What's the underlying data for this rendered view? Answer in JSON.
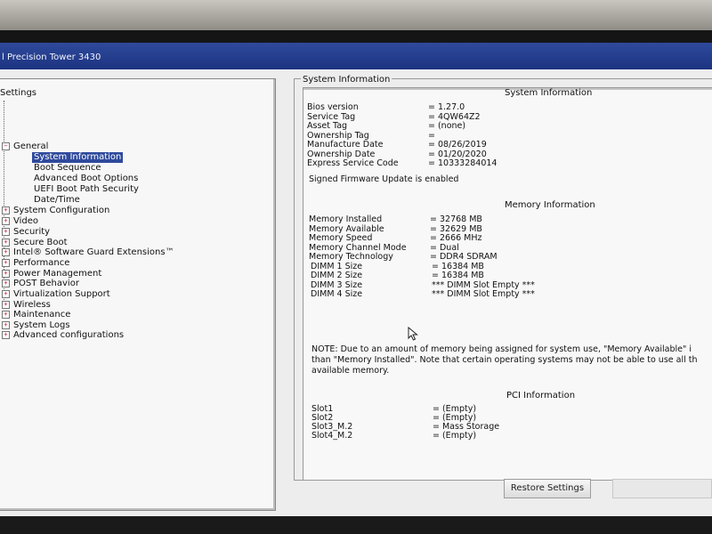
{
  "window": {
    "title": "l Precision Tower 3430"
  },
  "tree": {
    "root_label": "Settings",
    "general": {
      "label": "General",
      "children": [
        {
          "label": "System Information",
          "selected": true
        },
        {
          "label": "Boot Sequence"
        },
        {
          "label": "Advanced Boot Options"
        },
        {
          "label": "UEFI Boot Path Security"
        },
        {
          "label": "Date/Time"
        }
      ]
    },
    "categories": [
      "System Configuration",
      "Video",
      "Security",
      "Secure Boot",
      "Intel® Software Guard Extensions™",
      "Performance",
      "Power Management",
      "POST Behavior",
      "Virtualization Support",
      "Wireless",
      "Maintenance",
      "System Logs",
      "Advanced configurations"
    ]
  },
  "info": {
    "panel_title": "System Information",
    "system": {
      "heading": "System Information",
      "rows": [
        {
          "key": "Bios version",
          "value": "= 1.27.0"
        },
        {
          "key": "Service Tag",
          "value": "= 4QW64Z2"
        },
        {
          "key": "Asset Tag",
          "value": "= (none)"
        },
        {
          "key": "Ownership Tag",
          "value": "="
        },
        {
          "key": "Manufacture Date",
          "value": "= 08/26/2019"
        },
        {
          "key": "Ownership Date",
          "value": "= 01/20/2020"
        },
        {
          "key": "Express Service Code",
          "value": "= 10333284014"
        }
      ],
      "firmware_note": "Signed Firmware Update is enabled"
    },
    "memory": {
      "heading": "Memory Information",
      "rows": [
        {
          "key": "Memory Installed",
          "value": "= 32768 MB"
        },
        {
          "key": "Memory Available",
          "value": "= 32629 MB"
        },
        {
          "key": "Memory Speed",
          "value": "= 2666 MHz"
        },
        {
          "key": "Memory Channel Mode",
          "value": "= Dual"
        },
        {
          "key": "Memory Technology",
          "value": "= DDR4 SDRAM"
        },
        {
          "key": "DIMM 1 Size",
          "value": "= 16384 MB"
        },
        {
          "key": "DIMM 2 Size",
          "value": "= 16384 MB"
        },
        {
          "key": "DIMM 3 Size",
          "value": "*** DIMM Slot Empty ***"
        },
        {
          "key": "DIMM 4 Size",
          "value": "*** DIMM Slot Empty ***"
        }
      ],
      "note_lines": [
        "NOTE: Due to an amount of memory being assigned for system use, \"Memory Available\" i",
        "than \"Memory Installed\". Note that certain operating systems may not be able to use all th",
        "available memory."
      ]
    },
    "pci": {
      "heading": "PCI Information",
      "rows": [
        {
          "key": "Slot1",
          "value": "= (Empty)"
        },
        {
          "key": "Slot2",
          "value": "= (Empty)"
        },
        {
          "key": "Slot3_M.2",
          "value": "= Mass Storage"
        },
        {
          "key": "Slot4_M.2",
          "value": "= (Empty)"
        }
      ]
    }
  },
  "buttons": {
    "restore": "Restore Settings",
    "apply": ""
  }
}
